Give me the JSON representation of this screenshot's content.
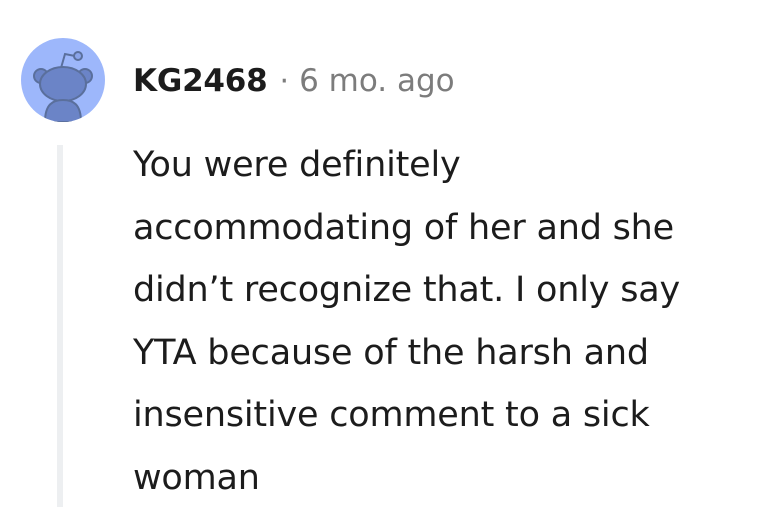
{
  "comment": {
    "author": "KG2468",
    "separator": "·",
    "age": "6 mo. ago",
    "avatar_icon": "reddit-snoo-icon",
    "avatar_color": "#9DB7FB",
    "body_lines": [
      "You were definitely",
      "accommodating of her and she",
      "didn’t recognize that. I only say",
      "YTA because of the harsh and",
      "insensitive comment to a sick",
      "woman"
    ]
  }
}
